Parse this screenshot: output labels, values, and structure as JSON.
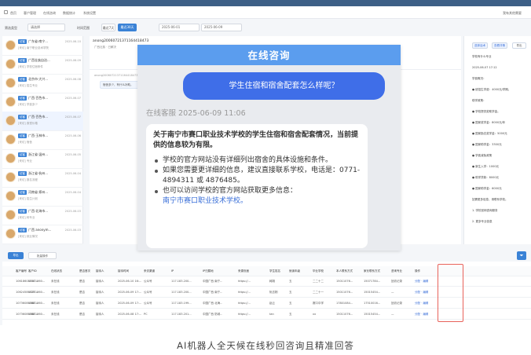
{
  "nav": {
    "items": [
      "首页",
      "客户管理",
      "在线咨询",
      "数据统计",
      "系统设置"
    ],
    "right": "我有其他需要"
  },
  "filter": {
    "type_label": "筛选类型",
    "type_value": "请选择",
    "time_label": "时间范围",
    "btn_all": "最近7天",
    "btn_today": "最近30天",
    "date_from": "2025-06-01",
    "date_to": "2025-06-09"
  },
  "list": [
    {
      "tag": "访客",
      "name": "广东省·南宁...",
      "date": "2025-06-10",
      "sub": "[来访] 南宁职业技术学院"
    },
    {
      "tag": "访客",
      "name": "广西壮族自治...",
      "date": "2025-06-09",
      "sub": "[来访] 学校住宿条件"
    },
    {
      "tag": "访客",
      "name": "北京市·大兴...",
      "date": "2025-06-08",
      "sub": "[来访] 招生专业"
    },
    {
      "tag": "访客",
      "name": "广西·百色市...",
      "date": "2025-06-07",
      "sub": "[来访] 学费多少"
    },
    {
      "tag": "访客",
      "name": "广西·百色市...",
      "date": "2025-06-07",
      "sub": "[来访] 食堂价格"
    },
    {
      "tag": "访客",
      "name": "广西·玉林市...",
      "date": "2025-06-06",
      "sub": "[来访] 宿舍"
    },
    {
      "tag": "访客",
      "name": "浙江省·温州...",
      "date": "2025-06-05",
      "sub": "[来访] 专业"
    },
    {
      "tag": "访客",
      "name": "浙江省·杭州...",
      "date": "2025-06-04",
      "sub": "[来访] 报名流程"
    },
    {
      "tag": "访客",
      "name": "河南省·郑州...",
      "date": "2025-06-04",
      "sub": "[来访] 招生计划"
    },
    {
      "tag": "访客",
      "name": "广西·北海市...",
      "date": "2025-06-03",
      "sub": "[来访] 转专业"
    },
    {
      "tag": "访客",
      "name": "广西 anonym...",
      "date": "2025-06-03",
      "sub": "[来访] 就业情况"
    }
  ],
  "chat": {
    "session": "anong20060721371164418473",
    "tags": "广西壮族 · 已解决",
    "meta": "anong20060721371164418473 2025-06-07 17:07",
    "bubble": "宿舍多少，有什么补助。"
  },
  "overlay": {
    "title": "在线咨询",
    "question": "学生住宿和宿舍配套怎么样呢？",
    "meta": "在线客服 2025-06-09 11:06",
    "intro": "关于南宁市赛口职业技术学校的学生住宿和宿舍配套情况，当前提供的信息较为有限。",
    "points": [
      "学校的官方网站没有详细列出宿舍的具体设施和条件。",
      "如果您需要更详细的信息，建议直接联系学校，电话是：0771-4894311 或 4876485。",
      "也可以访问学校的官方网站获取更多信息："
    ],
    "link": "南宁市赛口职业技术学校。"
  },
  "right": {
    "btns": [
      "选择话术",
      "查看详情",
      "导出"
    ],
    "lines": [
      "学校有什么专业",
      "2025-06-07 17:12",
      "学费概况：",
      "● 统招生学费：4000元/学期。",
      "助学政策：",
      "● 学校提供奖助学金。",
      "● 国家奖学金：8000元/年",
      "● 国家励志奖学金：5000元",
      "● 国家助学金：3300元",
      "● 学费减免政策",
      "● 新生入学：1000元",
      "● 助学贷款：8000元",
      "● 国家助学金：6000元",
      "如需更多信息，请联系学校。",
      "1. 学校官网咨询服务",
      "2. 更多专业信息"
    ]
  },
  "toolbar": {
    "export": "导出",
    "batch": "批量操作",
    "filter_icon": "filter-icon"
  },
  "table": {
    "headers": [
      "客户编号",
      "客户ID",
      "在线状态",
      "是否首次",
      "接待人",
      "接待时间",
      "来访渠道",
      "IP",
      "IP归属地",
      "来源页面",
      "学生姓名",
      "就读年级",
      "毕业学校",
      "本人联系方式",
      "家长联系方式",
      "咨询专业",
      "操作"
    ],
    "rows": [
      [
        "10618608010...",
        "13671860...",
        "未在线",
        "是否",
        "接待人",
        "2025-06-10 16:...",
        "公众号",
        "117.183.200...",
        "中国广西 南宁...",
        "https://...",
        "韩翔",
        "五",
        "二二十二",
        "15011076...",
        "15071784...",
        "回访记录",
        "分配 · 编辑"
      ],
      [
        "10624586028...",
        "13771860...",
        "未在线",
        "是否",
        "接待人",
        "2025-06-09 17:...",
        "公众号",
        "117.183.200...",
        "中国广西 南宁...",
        "https://...",
        "阮志刚",
        "五",
        "二二十一",
        "15011076...",
        "15015454...",
        "—",
        "分配 · 编辑"
      ],
      [
        "10736086088...",
        "13671860...",
        "未在线",
        "是否",
        "接待人",
        "2025-06-09 17:...",
        "公众号",
        "117.183.199...",
        "中国广西 北海...",
        "https://...",
        "赵云",
        "五",
        "赛口中学",
        "17801084...",
        "17510016...",
        "回访记录",
        "分配 · 编辑"
      ],
      [
        "10736086088...",
        "13671860...",
        "未在线",
        "是否",
        "接待人",
        "2025-06-08 17:...",
        "PC",
        "117.183.201...",
        "中国广西 防城...",
        "https://...",
        "tan",
        "五",
        "xx",
        "15011076...",
        "15015454...",
        "—",
        "分配 · 编辑"
      ]
    ]
  },
  "caption": "AI机器人全天候在线秒回咨询且精准回答"
}
